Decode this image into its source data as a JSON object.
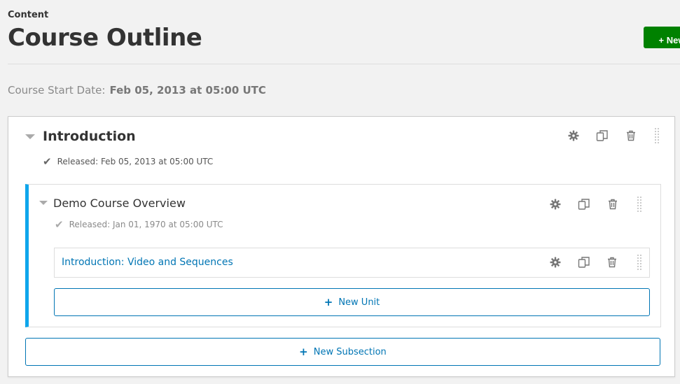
{
  "header": {
    "eyebrow": "Content",
    "title": "Course Outline",
    "new_button_label": "New"
  },
  "course_start": {
    "label": "Course Start Date:",
    "value": "Feb 05, 2013 at 05:00 UTC"
  },
  "section": {
    "title": "Introduction",
    "status": "Released: Feb 05, 2013 at 05:00 UTC",
    "add_subsection_label": "New Subsection",
    "subsection": {
      "title": "Demo Course Overview",
      "status": "Released: Jan 01, 1970 at 05:00 UTC",
      "unit": {
        "title": "Introduction: Video and Sequences"
      },
      "add_unit_label": "New Unit"
    }
  },
  "colors": {
    "primary_green": "#008100",
    "link_blue": "#0075b4",
    "subsection_accent": "#0ea6ec"
  },
  "icons": [
    "plus-icon",
    "chevron-down-icon",
    "check-icon",
    "gear-icon",
    "duplicate-icon",
    "trash-icon",
    "drag-handle-icon"
  ]
}
